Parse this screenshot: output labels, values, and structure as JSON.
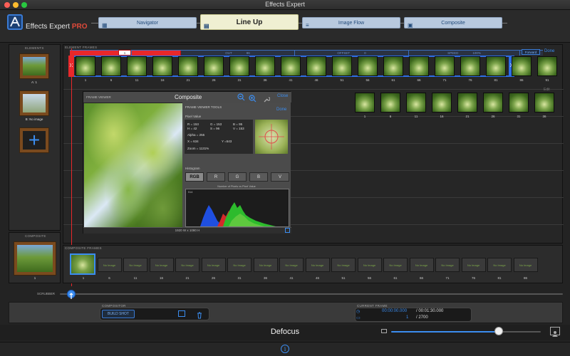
{
  "window": {
    "title": "Effects Expert"
  },
  "toolbar": {
    "app_name": "Effects Expert",
    "app_badge": "PRO",
    "tabs": [
      {
        "label": "Navigator",
        "icon": "grid-icon"
      },
      {
        "label": "Line Up",
        "icon": "lineup-icon",
        "active": true
      },
      {
        "label": "Image Flow",
        "icon": "flow-icon"
      },
      {
        "label": "Composite",
        "icon": "composite-icon"
      }
    ]
  },
  "elements_panel": {
    "label": "ELEMENTS",
    "items": [
      {
        "caption": "A: 1"
      },
      {
        "caption": "B: No image"
      }
    ]
  },
  "composite_panel": {
    "label": "COMPOSITE",
    "caption": "1"
  },
  "element_frames": {
    "label": "ELEMENT FRAMES",
    "segments": [
      "IN",
      "1",
      "OUT",
      "86",
      "OFFSET",
      "0",
      "SPEED",
      "100%"
    ],
    "direction": "Forward",
    "done": "Done",
    "frame_numbers": [
      "1",
      "6",
      "11",
      "16",
      "21",
      "26",
      "31",
      "36",
      "41",
      "46",
      "51",
      "56",
      "61",
      "66",
      "71",
      "76",
      "81",
      "86",
      "91"
    ],
    "edit_label": "Edit",
    "row2_numbers": [
      "1",
      "6",
      "11",
      "16",
      "21",
      "26",
      "31",
      "36"
    ]
  },
  "frame_viewer": {
    "label": "FRAME VIEWER",
    "title": "Composite",
    "close": "Close",
    "resolution": "1920 W x 1080 H",
    "tools": {
      "label": "FRAME VIEWER TOOLS",
      "done": "Done",
      "pixel_value_label": "Pixel Value",
      "r": "R = 153",
      "g": "G = 153",
      "b": "B = 95",
      "h": "H = 42",
      "s": "S = 96",
      "v": "V = 153",
      "alpha": "Alpha = 255",
      "x": "X = 634",
      "y": "Y =543",
      "zoom": "Zoom = 1131%",
      "histogram_label": "Histogram",
      "histogram_modes": [
        "RGB",
        "R",
        "G",
        "B",
        "V"
      ],
      "histogram_selected": "RGB",
      "histogram_title": "Number of Pixels vs Pixel Value",
      "histogram_max": "514"
    }
  },
  "composite_frames": {
    "label": "COMPOSITE FRAMES",
    "placeholder": "No Image",
    "numbers": [
      "1",
      "6",
      "11",
      "16",
      "21",
      "26",
      "31",
      "36",
      "41",
      "46",
      "51",
      "56",
      "61",
      "66",
      "71",
      "76",
      "81",
      "86"
    ]
  },
  "scrubber": {
    "label": "SCRUBBER"
  },
  "compositor": {
    "label": "COMPOSITOR",
    "build_shot": "BUILD SHOT"
  },
  "current_frame": {
    "label": "CURRENT FRAME",
    "timecode": "00:00:00.000",
    "duration": "/ 00:01:30.000",
    "frame": "1",
    "total_frames": "/ 2700"
  },
  "effect_name": "Defocus",
  "effect_slider": {
    "value_fraction": 0.72
  },
  "colors": {
    "accent": "#3b8df0",
    "in_marker": "#e8282b",
    "pro": "#e04a3a"
  }
}
